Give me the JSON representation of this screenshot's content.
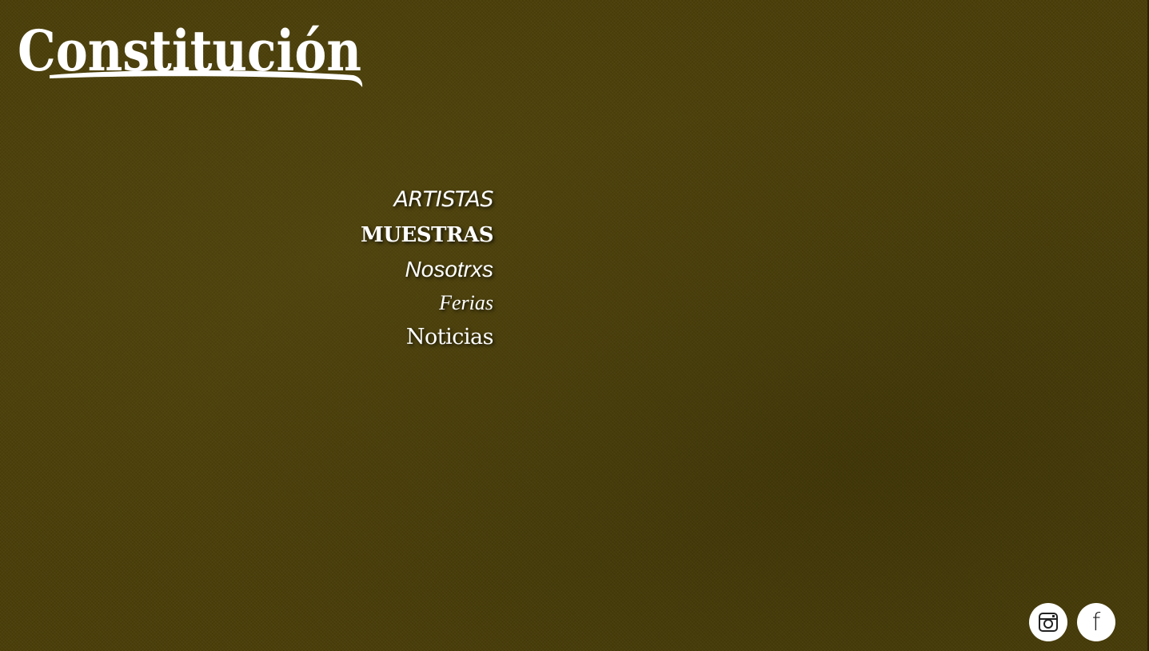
{
  "brand": {
    "logo_text": "Constitución"
  },
  "nav": {
    "items": [
      {
        "label": "ARTISTAS"
      },
      {
        "label": "MUESTRAS"
      },
      {
        "label": "Nosotrxs"
      },
      {
        "label": "Ferias"
      },
      {
        "label": "Noticias"
      }
    ]
  },
  "social": {
    "instagram_icon": "instagram-icon",
    "facebook_icon": "facebook-icon",
    "facebook_glyph": "f"
  },
  "colors": {
    "background": "#4a3e08",
    "text": "#ffffff",
    "icon_fill": "#ffffff",
    "icon_glyph": "#222222"
  }
}
